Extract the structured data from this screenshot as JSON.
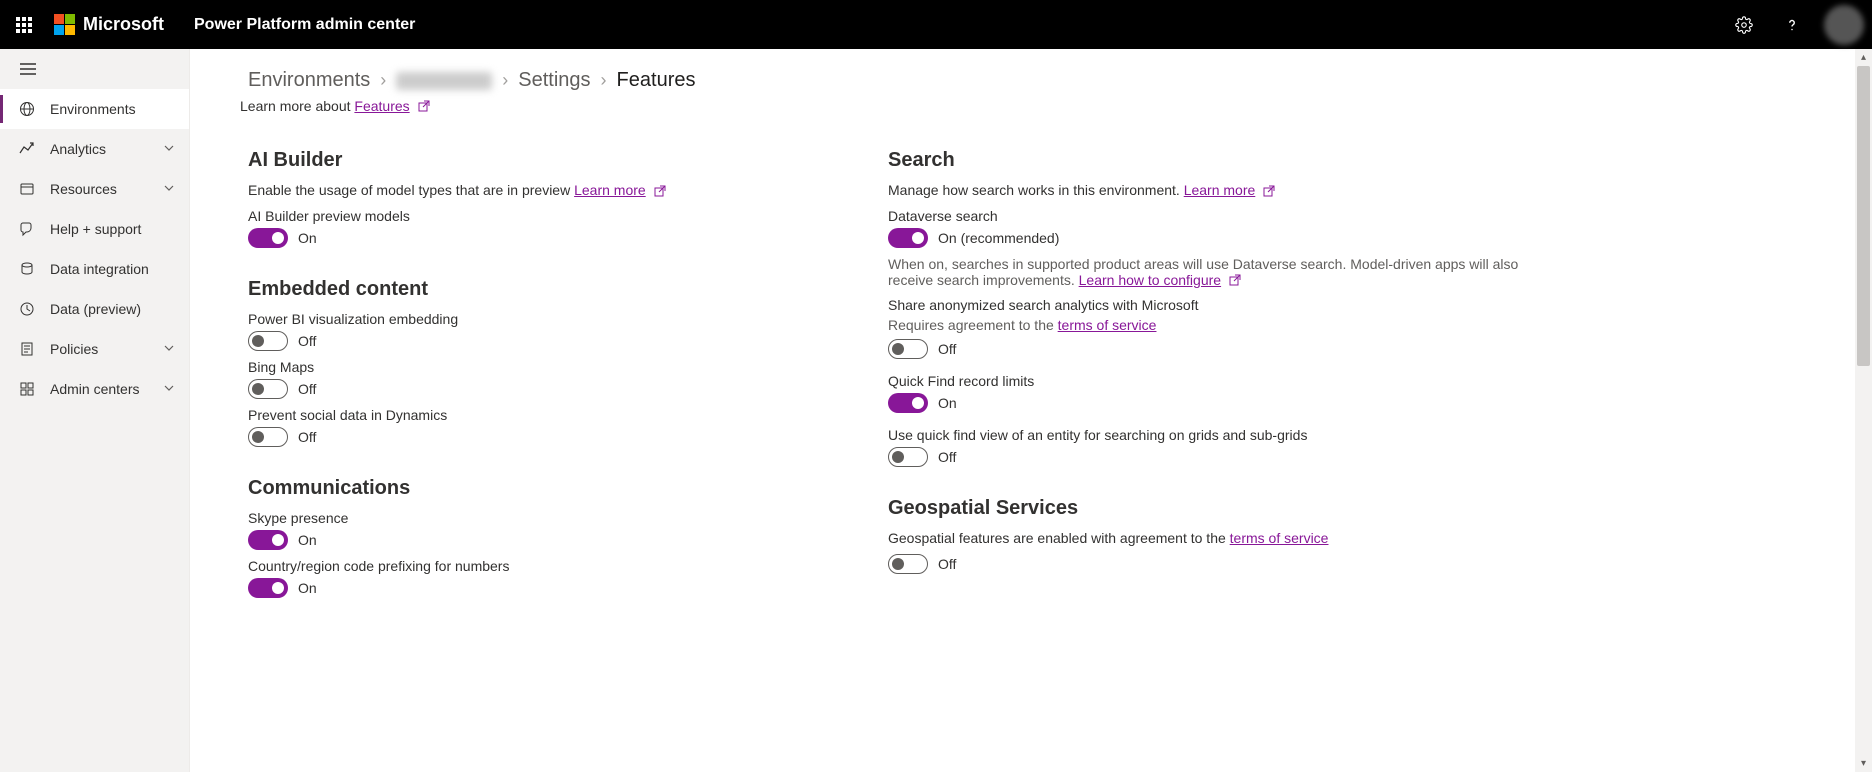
{
  "header": {
    "brand": "Microsoft",
    "app_title": "Power Platform admin center"
  },
  "sidebar": {
    "items": [
      {
        "label": "Environments",
        "icon": "environments",
        "active": true,
        "expandable": false
      },
      {
        "label": "Analytics",
        "icon": "analytics",
        "active": false,
        "expandable": true
      },
      {
        "label": "Resources",
        "icon": "resources",
        "active": false,
        "expandable": true
      },
      {
        "label": "Help + support",
        "icon": "help-support",
        "active": false,
        "expandable": false
      },
      {
        "label": "Data integration",
        "icon": "data-integration",
        "active": false,
        "expandable": false
      },
      {
        "label": "Data (preview)",
        "icon": "data-preview",
        "active": false,
        "expandable": false
      },
      {
        "label": "Policies",
        "icon": "policies",
        "active": false,
        "expandable": true
      },
      {
        "label": "Admin centers",
        "icon": "admin-centers",
        "active": false,
        "expandable": true
      }
    ]
  },
  "breadcrumb": {
    "root": "Environments",
    "settings": "Settings",
    "current": "Features"
  },
  "learn_more_row": {
    "prefix": "Learn more about ",
    "link": "Features"
  },
  "left": {
    "ai_builder": {
      "title": "AI Builder",
      "desc": "Enable the usage of model types that are in preview ",
      "learn_more": "Learn more",
      "preview_models_label": "AI Builder preview models",
      "preview_models_state": "On"
    },
    "embedded": {
      "title": "Embedded content",
      "powerbi_label": "Power BI visualization embedding",
      "powerbi_state": "Off",
      "bingmaps_label": "Bing Maps",
      "bingmaps_state": "Off",
      "prevent_social_label": "Prevent social data in Dynamics",
      "prevent_social_state": "Off"
    },
    "communications": {
      "title": "Communications",
      "skype_label": "Skype presence",
      "skype_state": "On",
      "country_label": "Country/region code prefixing for numbers",
      "country_state": "On"
    }
  },
  "right": {
    "search": {
      "title": "Search",
      "desc": "Manage how search works in this environment. ",
      "learn_more": "Learn more",
      "dataverse_label": "Dataverse search",
      "dataverse_state": "On (recommended)",
      "dataverse_desc1": "When on, searches in supported product areas will use Dataverse search. Model-driven apps will also receive search improvements. ",
      "dataverse_configure_link": "Learn how to configure",
      "share_label": "Share anonymized search analytics with Microsoft",
      "share_sub": "Requires agreement to the ",
      "share_tos": "terms of service",
      "share_state": "Off",
      "quickfind_label": "Quick Find record limits",
      "quickfind_state": "On",
      "quickfind_view_label": "Use quick find view of an entity for searching on grids and sub-grids",
      "quickfind_view_state": "Off"
    },
    "geo": {
      "title": "Geospatial Services",
      "desc": "Geospatial features are enabled with agreement to the ",
      "tos": "terms of service",
      "state": "Off"
    }
  }
}
